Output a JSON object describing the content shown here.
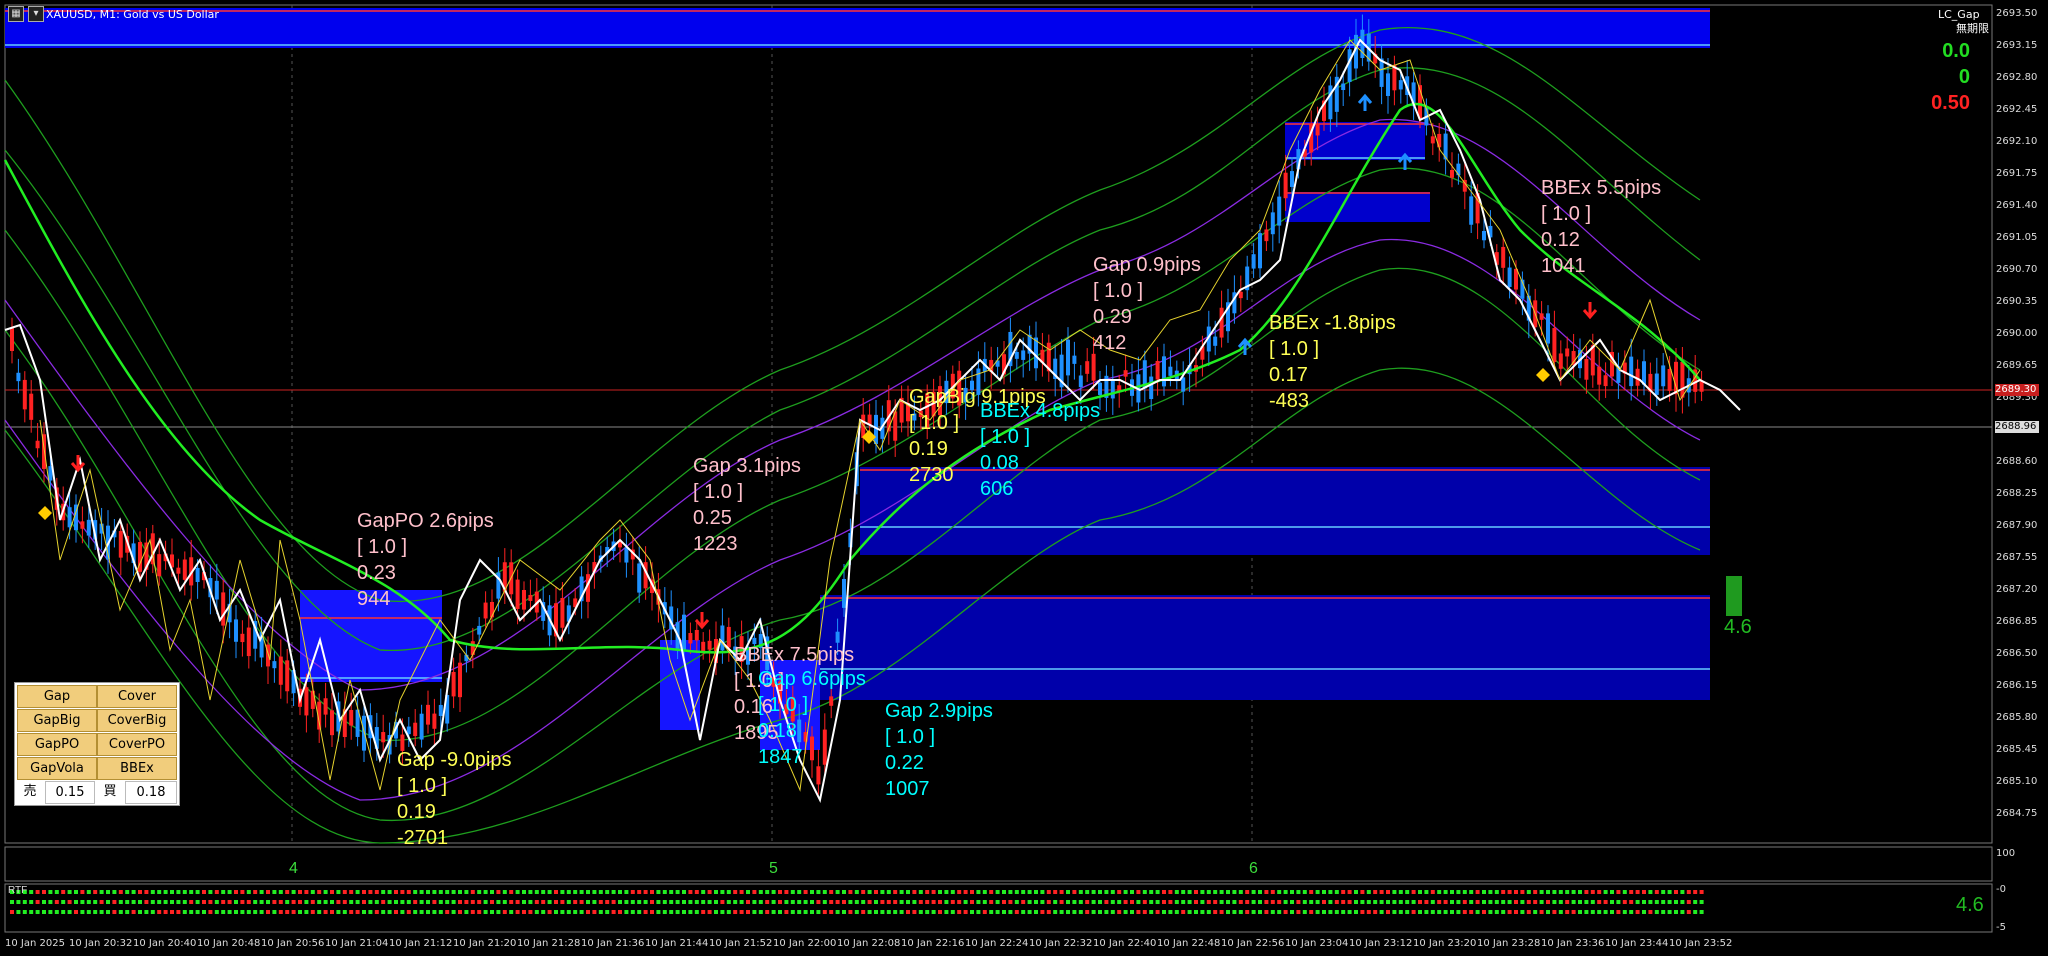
{
  "window": {
    "title": "XAUUSD, M1:  Gold vs US Dollar",
    "indicator_name": "LC_Gap",
    "expiry_label": "無期限"
  },
  "price_axis": [
    "2693.50",
    "2693.15",
    "2692.80",
    "2692.45",
    "2692.10",
    "2691.75",
    "2691.40",
    "2691.05",
    "2690.70",
    "2690.35",
    "2690.00",
    "2689.65",
    "2689.30",
    "2688.96",
    "2688.60",
    "2688.25",
    "2687.90",
    "2687.55",
    "2687.20",
    "2686.85",
    "2686.50",
    "2686.15",
    "2685.80",
    "2685.45",
    "2685.10",
    "2684.75"
  ],
  "price_markers": {
    "red_line": "2689.30",
    "current": "2688.96"
  },
  "time_axis": [
    "10 Jan 2025",
    "10 Jan 20:32",
    "10 Jan 20:40",
    "10 Jan 20:48",
    "10 Jan 20:56",
    "10 Jan 21:04",
    "10 Jan 21:12",
    "10 Jan 21:20",
    "10 Jan 21:28",
    "10 Jan 21:36",
    "10 Jan 21:44",
    "10 Jan 21:52",
    "10 Jan 22:00",
    "10 Jan 22:08",
    "10 Jan 22:16",
    "10 Jan 22:24",
    "10 Jan 22:32",
    "10 Jan 22:40",
    "10 Jan 22:48",
    "10 Jan 22:56",
    "10 Jan 23:04",
    "10 Jan 23:12",
    "10 Jan 23:20",
    "10 Jan 23:28",
    "10 Jan 23:36",
    "10 Jan 23:44",
    "10 Jan 23:52"
  ],
  "day_markers": [
    "4",
    "5",
    "6"
  ],
  "stats": {
    "v1": "0.0",
    "v2": "0",
    "v3": "0.50",
    "side_value": "4.6",
    "sub_value": "4.6"
  },
  "sub_window": {
    "label": "RTF",
    "levels": [
      "100",
      "-0",
      "-5"
    ]
  },
  "annotations": [
    {
      "lines": [
        "GapPO 2.6pips",
        "[ 1.0 ]",
        "0.23",
        "944"
      ],
      "color": "#ffc0cb"
    },
    {
      "lines": [
        "Gap -9.0pips",
        "[ 1.0 ]",
        "0.19",
        "-2701"
      ],
      "color": "#ffff55"
    },
    {
      "lines": [
        "Gap 3.1pips",
        "[ 1.0 ]",
        "0.25",
        "1223"
      ],
      "color": "#ffc0cb"
    },
    {
      "lines": [
        "BBEx 7.5pips",
        "[ 1.0 ]",
        "0.16",
        "1895"
      ],
      "color": "#ffc0cb"
    },
    {
      "lines": [
        "Gap 6.6pips",
        "[ 1.0 ]",
        "0.18",
        "1847"
      ],
      "color": "#00ffff"
    },
    {
      "lines": [
        "Gap 2.9pips",
        "[ 1.0 ]",
        "0.22",
        "1007"
      ],
      "color": "#00ffff"
    },
    {
      "lines": [
        "GapBig 9.1pips",
        "[ 1.0 ]",
        "0.19",
        "2730"
      ],
      "color": "#ffff55"
    },
    {
      "lines": [
        "BBEx 4.8pips",
        "[ 1.0 ]",
        "0.08",
        "606"
      ],
      "color": "#00ffff"
    },
    {
      "lines": [
        "Gap 0.9pips",
        "[ 1.0 ]",
        "0.29",
        "412"
      ],
      "color": "#ffc0cb"
    },
    {
      "lines": [
        "BBEx -1.8pips",
        "[ 1.0 ]",
        "0.17",
        "-483"
      ],
      "color": "#ffff55"
    },
    {
      "lines": [
        "BBEx 5.5pips",
        "[ 1.0 ]",
        "0.12",
        "1041"
      ],
      "color": "#ffc0cb"
    }
  ],
  "panel": {
    "buttons": [
      [
        "Gap",
        "Cover"
      ],
      [
        "GapBig",
        "CoverBig"
      ],
      [
        "GapPO",
        "CoverPO"
      ],
      [
        "GapVola",
        "BBEx"
      ]
    ],
    "sell_label": "売",
    "sell_value": "0.15",
    "buy_label": "買",
    "buy_value": "0.18"
  },
  "colors": {
    "zone": "#0000ee",
    "bull": "#1e90ff",
    "bear": "#ff2222",
    "ma": "#22ee22",
    "price": "#ffffff"
  }
}
